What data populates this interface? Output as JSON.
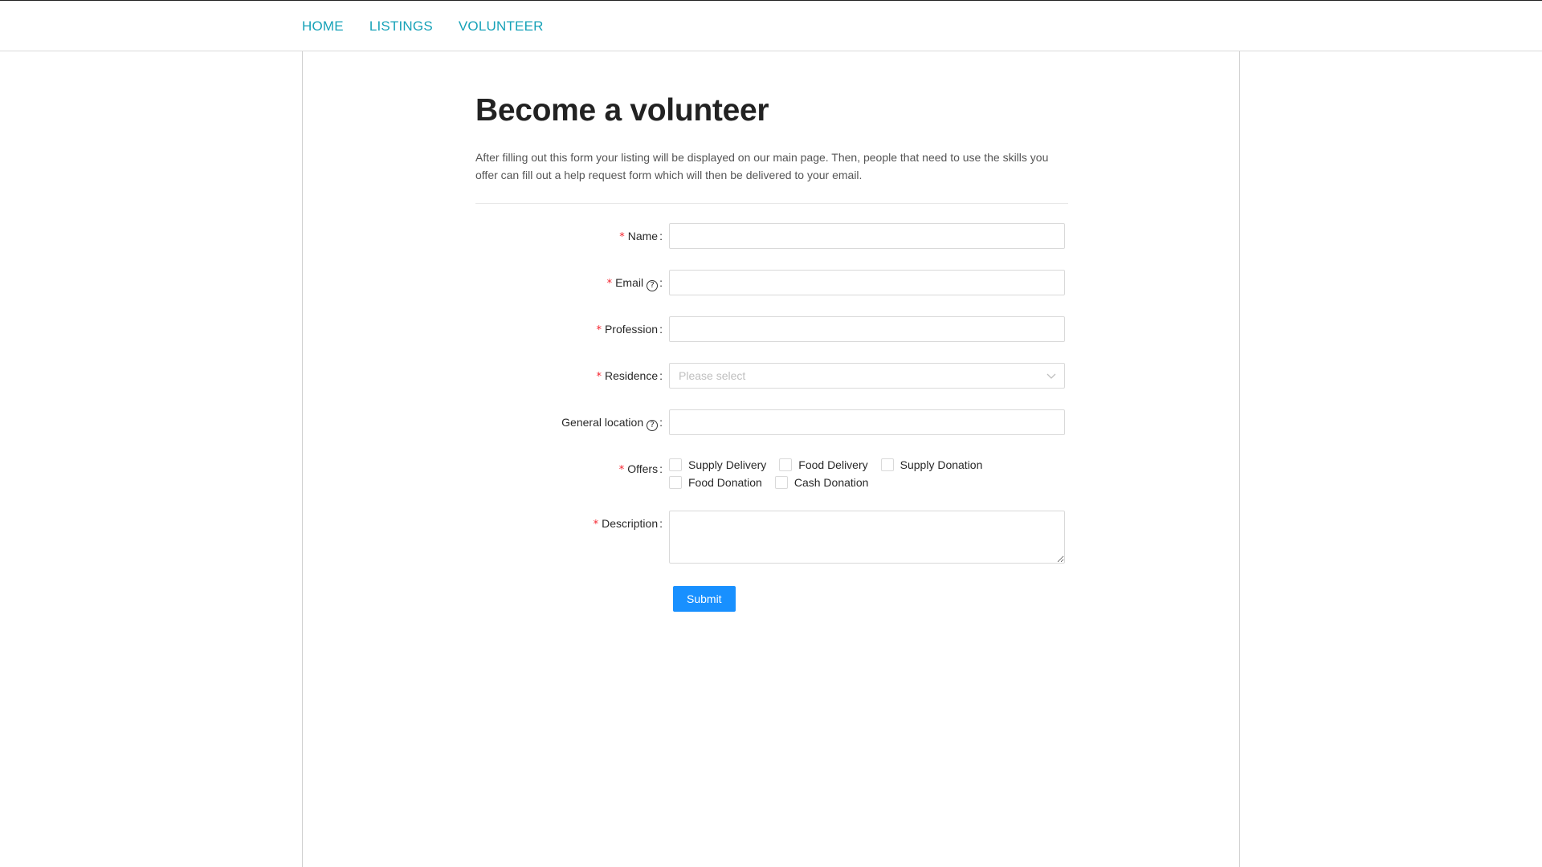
{
  "nav": {
    "items": [
      {
        "label": "HOME"
      },
      {
        "label": "LISTINGS"
      },
      {
        "label": "VOLUNTEER"
      }
    ],
    "link_color": "#17a2b8"
  },
  "page": {
    "title": "Become a volunteer",
    "intro": "After filling out this form your listing will be displayed on our main page. Then, people that need to use the skills you offer can fill out a help request form which will then be delivered to your email."
  },
  "form": {
    "required_mark": "*",
    "help_icon": "question-circle-icon",
    "name": {
      "label": "Name",
      "value": ""
    },
    "email": {
      "label": "Email",
      "value": ""
    },
    "profession": {
      "label": "Profession",
      "value": ""
    },
    "residence": {
      "label": "Residence",
      "placeholder": "Please select"
    },
    "location": {
      "label": "General location",
      "value": ""
    },
    "offers": {
      "label": "Offers",
      "options": [
        "Supply Delivery",
        "Food Delivery",
        "Supply Donation",
        "Food Donation",
        "Cash Donation"
      ]
    },
    "description": {
      "label": "Description",
      "value": ""
    },
    "submit_label": "Submit",
    "accent_color": "#1890ff",
    "required_color": "#f5222d"
  }
}
